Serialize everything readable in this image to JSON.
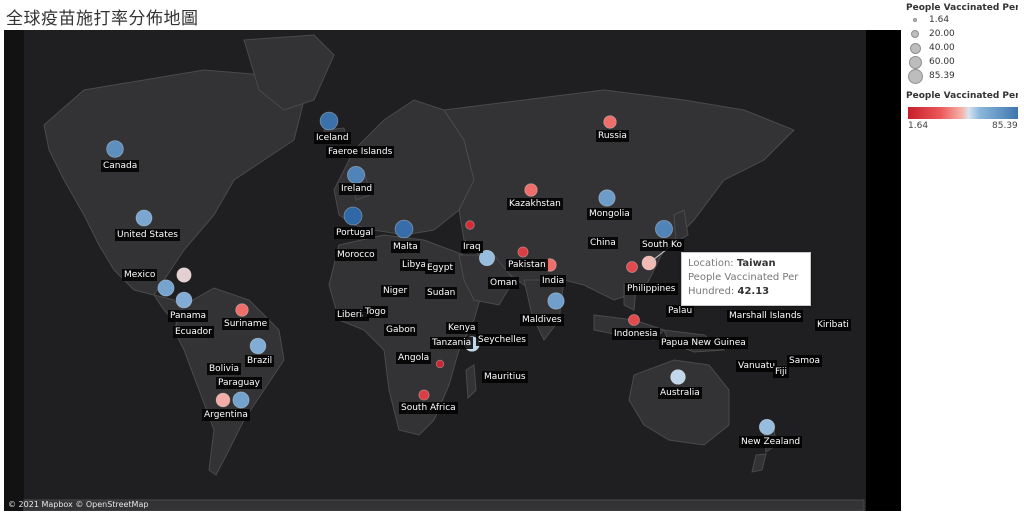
{
  "page": {
    "title": "全球疫苗施打率分佈地圖"
  },
  "map": {
    "attribution": "© 2021 Mapbox  © OpenStreetMap",
    "colors": {
      "ocean": "#1f1f21",
      "land": "#333335",
      "border": "#4a4a4c",
      "low": "#d7191c",
      "high": "#2c6bad"
    },
    "labels": [
      "Canada",
      "Iceland",
      "Faeroe Islands",
      "Ireland",
      "Portugal",
      "United States",
      "Malta",
      "Morocco",
      "Libya",
      "Egypt",
      "Russia",
      "Kazakhstan",
      "Mongolia",
      "China",
      "South Ko",
      "Iraq",
      "Pakistan",
      "Oman",
      "India",
      "Mexico",
      "Panama",
      "Ecuador",
      "Suriname",
      "Niger",
      "Sudan",
      "Liberia",
      "Togo",
      "Gabon",
      "Kenya",
      "Tanzania",
      "Seychelles",
      "Maldives",
      "Philippines",
      "Palau",
      "Marshall Islands",
      "Kiribati",
      "Indonesia",
      "Papua New Guinea",
      "Angola",
      "Mauritius",
      "Vanuatu",
      "Samoa",
      "Fiji",
      "Brazil",
      "Bolivia",
      "Paraguay",
      "Argentina",
      "South Africa",
      "Australia",
      "New Zealand"
    ]
  },
  "chart_data": {
    "type": "map",
    "measure": "People Vaccinated Per Hundred",
    "range": [
      1.64,
      85.39
    ],
    "points": [
      {
        "name": "Canada",
        "value": 71.0
      },
      {
        "name": "United States",
        "value": 62.0
      },
      {
        "name": "Iceland",
        "value": 82.0
      },
      {
        "name": "Ireland",
        "value": 75.0
      },
      {
        "name": "Portugal",
        "value": 85.39
      },
      {
        "name": "Malta",
        "value": 83.0
      },
      {
        "name": "Mexico",
        "value": 45.0
      },
      {
        "name": "Panama",
        "value": 60.0
      },
      {
        "name": "Ecuador",
        "value": 63.0
      },
      {
        "name": "Suriname",
        "value": 30.0
      },
      {
        "name": "Brazil",
        "value": 60.0
      },
      {
        "name": "Argentina",
        "value": 64.0
      },
      {
        "name": "Paraguay",
        "value": 40.0
      },
      {
        "name": "Russia",
        "value": 30.0
      },
      {
        "name": "Kazakhstan",
        "value": 30.0
      },
      {
        "name": "Mongolia",
        "value": 66.0
      },
      {
        "name": "China",
        "value": 75.0
      },
      {
        "name": "Taiwan",
        "value": 42.13
      },
      {
        "name": "Iraq",
        "value": 8.0
      },
      {
        "name": "Oman",
        "value": 55.0
      },
      {
        "name": "India",
        "value": 30.0
      },
      {
        "name": "Pakistan",
        "value": 15.0
      },
      {
        "name": "Maldives",
        "value": 65.0
      },
      {
        "name": "Philippines",
        "value": 20.0
      },
      {
        "name": "Indonesia",
        "value": 20.0
      },
      {
        "name": "Australia",
        "value": 50.0
      },
      {
        "name": "New Zealand",
        "value": 55.0
      },
      {
        "name": "South Africa",
        "value": 15.0
      },
      {
        "name": "Angola",
        "value": 5.0
      },
      {
        "name": "Mauritius",
        "value": 50.0
      }
    ]
  },
  "tooltip": {
    "location_key": "Location:",
    "location_value": "Taiwan",
    "measure_key": "People Vaccinated Per Hundred:",
    "measure_value": "42.13"
  },
  "legend": {
    "size_title": "People Vaccinated Per Hu...",
    "size_values": [
      "1.64",
      "20.00",
      "40.00",
      "60.00",
      "85.39"
    ],
    "color_title": "People Vaccinated Per Hu...",
    "color_min": "1.64",
    "color_max": "85.39"
  }
}
